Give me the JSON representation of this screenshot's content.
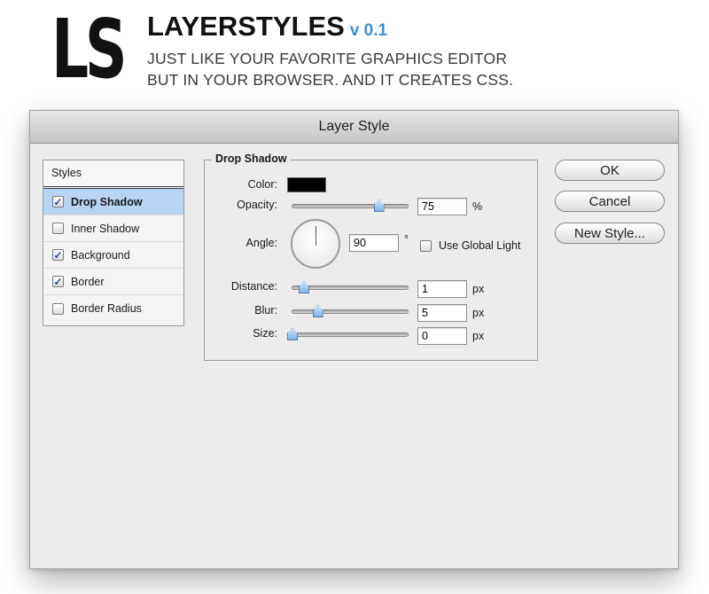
{
  "header": {
    "logo_text": "LS",
    "title": "LAYERSTYLES",
    "version": "v 0.1",
    "tagline_line1": "JUST LIKE YOUR FAVORITE GRAPHICS EDITOR",
    "tagline_line2": "BUT IN YOUR BROWSER. AND IT CREATES CSS.",
    "version_color": "#3b8fd0"
  },
  "dialog": {
    "title": "Layer Style",
    "styles_panel": {
      "header": "Styles",
      "items": [
        {
          "label": "Drop Shadow",
          "checked": true,
          "selected": true
        },
        {
          "label": "Inner Shadow",
          "checked": false,
          "selected": false
        },
        {
          "label": "Background",
          "checked": true,
          "selected": false
        },
        {
          "label": "Border",
          "checked": true,
          "selected": false
        },
        {
          "label": "Border Radius",
          "checked": false,
          "selected": false
        }
      ]
    },
    "drop_shadow": {
      "legend": "Drop Shadow",
      "color_label": "Color:",
      "color_value": "#000000",
      "opacity_label": "Opacity:",
      "opacity_value": "75",
      "opacity_unit": "%",
      "angle_label": "Angle:",
      "angle_value": "90",
      "angle_unit": "°",
      "use_global_light_label": "Use Global Light",
      "use_global_light_checked": false,
      "distance_label": "Distance:",
      "distance_value": "1",
      "blur_label": "Blur:",
      "blur_value": "5",
      "size_label": "Size:",
      "size_value": "0",
      "px_unit": "px",
      "sliders": {
        "opacity_fraction": 0.75,
        "distance_fraction": 0.1,
        "blur_fraction": 0.22,
        "size_fraction": 0.0
      }
    },
    "buttons": {
      "ok": "OK",
      "cancel": "Cancel",
      "new_style": "New Style..."
    },
    "selection_color": "#b7d4f5"
  }
}
